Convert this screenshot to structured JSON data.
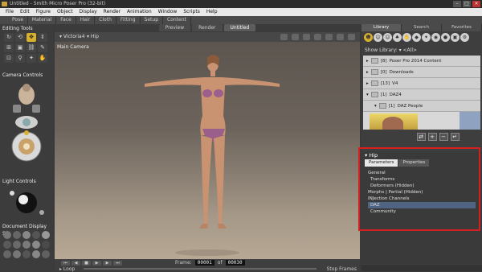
{
  "window": {
    "title": "Untitled - Smith Micro Poser Pro  (32-bit)"
  },
  "menu": [
    "File",
    "Edit",
    "Figure",
    "Object",
    "Display",
    "Render",
    "Animation",
    "Window",
    "Scripts",
    "Help"
  ],
  "rooms": [
    "Pose",
    "Material",
    "Face",
    "Hair",
    "Cloth",
    "Fitting",
    "Setup",
    "Content"
  ],
  "left": {
    "editing_tools_label": "Editing Tools",
    "camera_controls_label": "Camera Controls",
    "light_controls_label": "Light Controls",
    "document_display_label": "Document Display S"
  },
  "viewport": {
    "tabs": [
      "Preview",
      "Render",
      "Untitled"
    ],
    "figure": "Victoria4",
    "body_part": "Hip",
    "camera_label": "Main Camera"
  },
  "playback": {
    "frame_label": "Frame:",
    "current_frame": "00001",
    "of_label": "of",
    "total_frames": "00030",
    "loop_label": "Loop",
    "stop_frames_label": "Stop Frames"
  },
  "library": {
    "tabs": [
      "Library",
      "Search",
      "Favorites"
    ],
    "show_library_label": "Show Library:",
    "show_library_value": "<All>",
    "folders": [
      {
        "count": "[8]",
        "name": "Poser Pro 2014 Content"
      },
      {
        "count": "[0]",
        "name": "Downloads"
      },
      {
        "count": "[13]",
        "name": "V4"
      },
      {
        "count": "[1]",
        "name": "DAZ4"
      }
    ],
    "subfolder": {
      "count": "[1]",
      "name": "DAZ People"
    }
  },
  "parameters": {
    "title": "Hip",
    "tabs": [
      "Parameters",
      "Properties"
    ],
    "groups": [
      "General",
      "Transforms",
      "Deformers (Hidden)",
      "Morphs | Partial (Hidden)",
      "INJection Channels",
      "DAZ",
      "Community"
    ]
  }
}
